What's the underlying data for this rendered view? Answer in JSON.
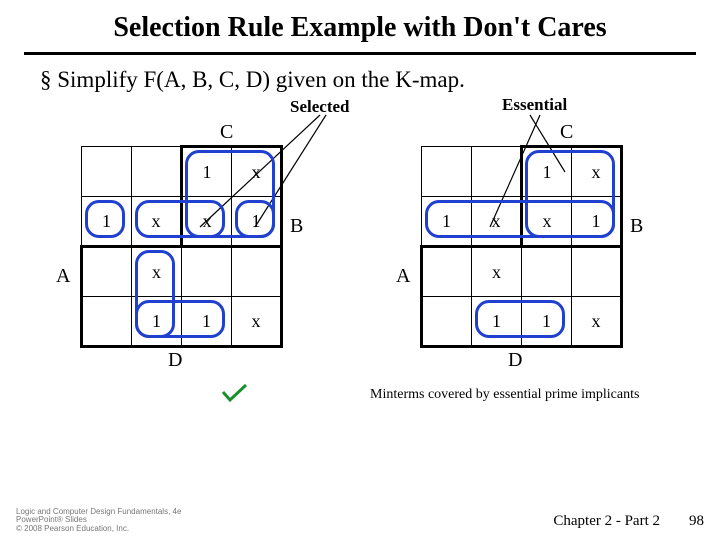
{
  "title": "Selection Rule Example with Don't Cares",
  "bullet": "Simplify F(A, B, C, D) given on the K-map.",
  "labels": {
    "selected": "Selected",
    "essential": "Essential"
  },
  "vars": {
    "A": "A",
    "B": "B",
    "C": "C",
    "D": "D"
  },
  "kmap": {
    "left": {
      "rows": [
        [
          "",
          "",
          "1",
          "x"
        ],
        [
          "1",
          "x",
          "x",
          "1"
        ],
        [
          "",
          "x",
          "",
          ""
        ],
        [
          "",
          "1",
          "1",
          "x"
        ]
      ]
    },
    "right": {
      "rows": [
        [
          "",
          "",
          "1",
          "x"
        ],
        [
          "1",
          "x",
          "x",
          "1"
        ],
        [
          "",
          "x",
          "",
          ""
        ],
        [
          "",
          "1",
          "1",
          "x"
        ]
      ]
    }
  },
  "minterms_caption": "Minterms covered by essential prime implicants",
  "footer": {
    "l1": "Logic and Computer Design Fundamentals, 4e",
    "l2": "PowerPoint® Slides",
    "l3": "© 2008 Pearson Education, Inc."
  },
  "chapter": "Chapter 2 - Part 2",
  "pagenum": "98",
  "chart_data": {
    "type": "table",
    "description": "Two 4x4 Karnaugh maps for F(A,B,C,D). Columns follow Gray code on CD (00,01,11,10); rows on AB (00,01,11,10). Entries are 1, x (don't-care), or blank (0).",
    "left_map": [
      [
        "",
        "",
        "1",
        "x"
      ],
      [
        "1",
        "x",
        "x",
        "1"
      ],
      [
        "",
        "x",
        "",
        ""
      ],
      [
        "",
        "1",
        "1",
        "x"
      ]
    ],
    "right_map": [
      [
        "",
        "",
        "1",
        "x"
      ],
      [
        "1",
        "x",
        "x",
        "1"
      ],
      [
        "",
        "x",
        "",
        ""
      ],
      [
        "",
        "1",
        "1",
        "x"
      ]
    ],
    "left_groupings": [
      "Selected prime implicants circled"
    ],
    "right_groupings": [
      "Essential prime implicants circled"
    ]
  }
}
